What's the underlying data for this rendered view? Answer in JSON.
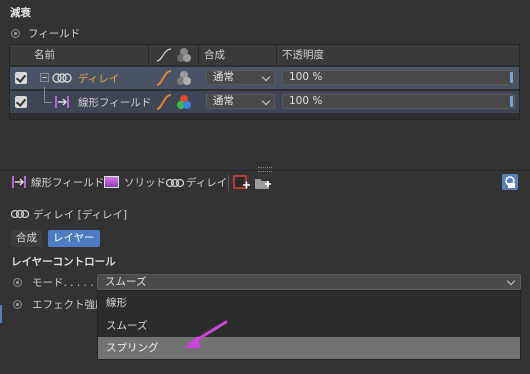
{
  "section_title": "減衰",
  "fields_radio_label": "フィールド",
  "table": {
    "headers": {
      "name": "名前",
      "blend": "合成",
      "opacity": "不透明度"
    },
    "rows": [
      {
        "name": "ディレイ",
        "blend": "通常",
        "opacity": "100 %",
        "checked": true
      },
      {
        "name": "線形フィールド",
        "blend": "通常",
        "opacity": "100 %",
        "checked": true
      }
    ]
  },
  "toolbar": {
    "tabs": [
      "線形フィールド",
      "ソリッド",
      "ディレイ"
    ]
  },
  "object_title": "ディレイ [ディレイ]",
  "subtabs": {
    "blend": "合成",
    "layer": "レイヤー"
  },
  "layer_controls_title": "レイヤーコントロール",
  "mode_label": "モード. . . . .",
  "effect_label": "エフェクト強度",
  "mode_dropdown": {
    "selected": "スムーズ",
    "options": [
      "線形",
      "スムーズ",
      "スプリング"
    ],
    "highlighted": "スプリング"
  },
  "colors": {
    "background": "#333333",
    "row_selected": "#4a5366",
    "accent_orange": "#e58a2a",
    "accent_purple": "#b46ad8",
    "arrow_magenta": "#cc44dd"
  }
}
